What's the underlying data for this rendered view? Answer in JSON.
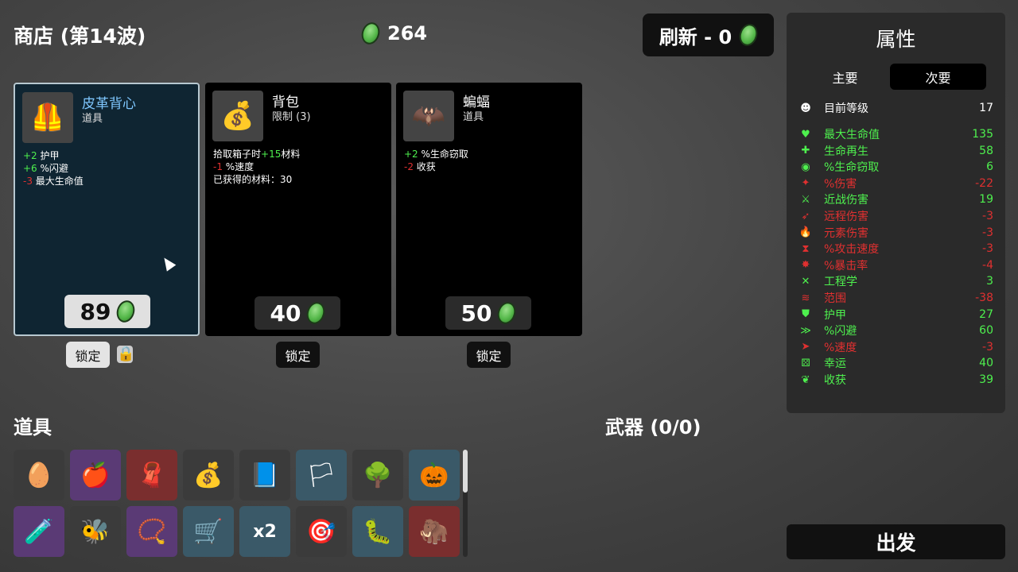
{
  "header": {
    "shop_title": "商店 (第14波)",
    "materials": "264",
    "reroll_label": "刷新 - 0"
  },
  "cards": [
    {
      "name": "皮革背心",
      "tag": "道具",
      "icon": "leather-vest-icon",
      "price": "89",
      "lock_label": "锁定",
      "locked": true,
      "effects": [
        {
          "val": "+2",
          "text": " 护甲",
          "sign": "pos"
        },
        {
          "val": "+6",
          "text": " %闪避",
          "sign": "pos"
        },
        {
          "val": "-3",
          "text": " 最大生命值",
          "sign": "neg"
        }
      ]
    },
    {
      "name": "背包",
      "tag": "限制 (3)",
      "icon": "bag-icon",
      "price": "40",
      "lock_label": "锁定",
      "locked": false,
      "effects": [
        {
          "pre": "拾取箱子时",
          "val": "+15",
          "text": "材料",
          "sign": "pos"
        },
        {
          "val": "-1",
          "text": " %速度",
          "sign": "neg"
        },
        {
          "pre": "已获得的材料：30",
          "val": "",
          "text": "",
          "sign": "pos"
        }
      ]
    },
    {
      "name": "蝙蝠",
      "tag": "道具",
      "icon": "bat-icon",
      "price": "50",
      "lock_label": "锁定",
      "locked": false,
      "effects": [
        {
          "val": "+2",
          "text": " %生命窃取",
          "sign": "pos"
        },
        {
          "val": "-2",
          "text": " 收获",
          "sign": "neg"
        }
      ]
    }
  ],
  "items_title": "道具",
  "weapons_title": "武器 (0/0)",
  "inventory": [
    {
      "icon": "alien-egg-icon",
      "rarity": "common",
      "glyph": "🥚"
    },
    {
      "icon": "apple-icon",
      "rarity": "purple",
      "glyph": "🍎"
    },
    {
      "icon": "cape-icon",
      "rarity": "red",
      "glyph": "🧣"
    },
    {
      "icon": "bag-icon",
      "rarity": "common",
      "glyph": "💰"
    },
    {
      "icon": "book-icon",
      "rarity": "common",
      "glyph": "📘"
    },
    {
      "icon": "white-flag-icon",
      "rarity": "blue",
      "glyph": "🏳"
    },
    {
      "icon": "tree-icon",
      "rarity": "common",
      "glyph": "🌳"
    },
    {
      "icon": "pumpkin-icon",
      "rarity": "blue",
      "glyph": "🎃"
    },
    {
      "icon": "potion-icon",
      "rarity": "purple",
      "glyph": "🧪"
    },
    {
      "icon": "bee-icon",
      "rarity": "common",
      "glyph": "🐝"
    },
    {
      "icon": "amulet-icon",
      "rarity": "purple",
      "glyph": "📿"
    },
    {
      "icon": "wheelbarrow-icon",
      "rarity": "blue",
      "glyph": "🛒"
    },
    {
      "icon": "dice-stack-icon",
      "rarity": "blue",
      "glyph": "x2"
    },
    {
      "icon": "target-dummy-icon",
      "rarity": "common",
      "glyph": "🎯"
    },
    {
      "icon": "leech-icon",
      "rarity": "blue",
      "glyph": "🐛"
    },
    {
      "icon": "mammoth-icon",
      "rarity": "red",
      "glyph": "🦣"
    }
  ],
  "stats": {
    "title": "属性",
    "tab_primary": "主要",
    "tab_secondary": "次要",
    "level_label": "目前等级",
    "level_value": "17",
    "rows": [
      {
        "icon": "heart-icon",
        "glyph": "♥",
        "color": "#4ef04e",
        "name": "最大生命值",
        "value": "135"
      },
      {
        "icon": "regen-icon",
        "glyph": "✚",
        "color": "#4ef04e",
        "name": "生命再生",
        "value": "58"
      },
      {
        "icon": "lifesteal-icon",
        "glyph": "◉",
        "color": "#4ef04e",
        "name": "%生命窃取",
        "value": "6"
      },
      {
        "icon": "damage-icon",
        "glyph": "✦",
        "color": "#e03030",
        "name": "%伤害",
        "value": "-22"
      },
      {
        "icon": "melee-icon",
        "glyph": "⚔",
        "color": "#4ef04e",
        "name": "近战伤害",
        "value": "19"
      },
      {
        "icon": "ranged-icon",
        "glyph": "➶",
        "color": "#e03030",
        "name": "远程伤害",
        "value": "-3"
      },
      {
        "icon": "elemental-icon",
        "glyph": "🔥",
        "color": "#e03030",
        "name": "元素伤害",
        "value": "-3"
      },
      {
        "icon": "attack-speed-icon",
        "glyph": "⧗",
        "color": "#e03030",
        "name": "%攻击速度",
        "value": "-3"
      },
      {
        "icon": "crit-icon",
        "glyph": "✸",
        "color": "#e03030",
        "name": "%暴击率",
        "value": "-4"
      },
      {
        "icon": "engineering-icon",
        "glyph": "✕",
        "color": "#4ef04e",
        "name": "工程学",
        "value": "3"
      },
      {
        "icon": "range-icon",
        "glyph": "≋",
        "color": "#e03030",
        "name": "范围",
        "value": "-38"
      },
      {
        "icon": "armor-icon",
        "glyph": "⛊",
        "color": "#4ef04e",
        "name": "护甲",
        "value": "27"
      },
      {
        "icon": "dodge-icon",
        "glyph": "≫",
        "color": "#4ef04e",
        "name": "%闪避",
        "value": "60"
      },
      {
        "icon": "speed-icon",
        "glyph": "➤",
        "color": "#e03030",
        "name": "%速度",
        "value": "-3"
      },
      {
        "icon": "luck-icon",
        "glyph": "⚄",
        "color": "#4ef04e",
        "name": "幸运",
        "value": "40"
      },
      {
        "icon": "harvesting-icon",
        "glyph": "❦",
        "color": "#4ef04e",
        "name": "收获",
        "value": "39"
      }
    ]
  },
  "go_label": "出发"
}
